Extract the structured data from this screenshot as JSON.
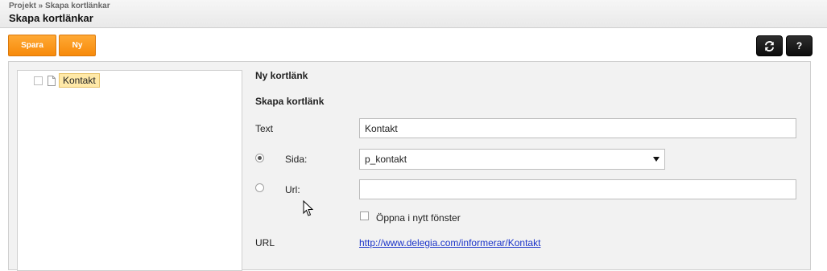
{
  "header": {
    "breadcrumb": "Projekt » Skapa kortlänkar",
    "title": "Skapa kortlänkar"
  },
  "toolbar": {
    "save_label": "Spara",
    "new_label": "Ny",
    "refresh_icon": "refresh-icon",
    "help_label": "?"
  },
  "tree": {
    "items": [
      {
        "label": "Kontakt",
        "icon": "document-icon",
        "checked": false,
        "selected": true
      }
    ]
  },
  "form": {
    "heading": "Ny kortlänk",
    "subheading": "Skapa kortlänk",
    "text_label": "Text",
    "text_value": "Kontakt",
    "page_label": "Sida:",
    "page_value": "p_kontakt",
    "url_option_label": "Url:",
    "url_value": "",
    "new_window_label": "Öppna i nytt fönster",
    "result_label": "URL",
    "result_link": "http://www.delegia.com/informerar/Kontakt"
  },
  "colors": {
    "accent_orange": "#f7941d",
    "dark_button": "#1a1a1a",
    "link": "#1a33c9",
    "panel_bg": "#f2f2f2",
    "tree_highlight": "#ffe9a8"
  }
}
